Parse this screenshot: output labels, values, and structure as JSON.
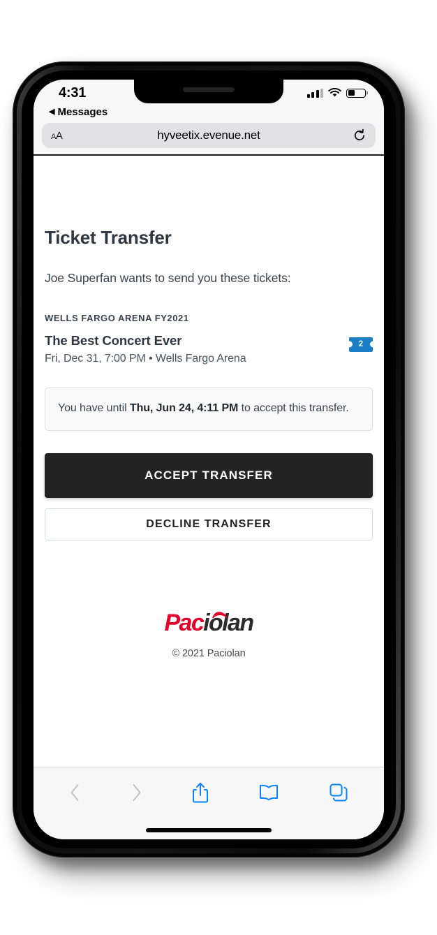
{
  "status_bar": {
    "time": "4:31",
    "back_label": "Messages",
    "back_caret": "◀",
    "signal_icon": "cellular-signal-icon",
    "wifi_icon": "wifi-icon",
    "battery_icon": "battery-icon",
    "battery_level_percent": 42
  },
  "browser": {
    "font_size_label_small": "A",
    "font_size_label_large": "A",
    "url": "hyveetix.evenue.net",
    "reload_icon": "reload-icon",
    "toolbar": {
      "back_icon": "chevron-left-icon",
      "forward_icon": "chevron-right-icon",
      "share_icon": "share-icon",
      "bookmarks_icon": "book-icon",
      "tabs_icon": "tabs-icon",
      "enabled_color": "#0a84ff",
      "disabled_color": "#c2c2c4"
    }
  },
  "page": {
    "title": "Ticket Transfer",
    "subtitle": "Joe Superfan wants to send you these tickets:",
    "event": {
      "group_name": "WELLS FARGO ARENA FY2021",
      "name": "The Best Concert Ever",
      "datetime_venue": "Fri, Dec 31, 7:00 PM • Wells Fargo Arena",
      "ticket_count": "2",
      "ticket_badge_color": "#1a7ec4",
      "ticket_badge_icon": "ticket-icon"
    },
    "deadline_notice": {
      "prefix": "You have until ",
      "date": "Thu, Jun 24, 4:11 PM",
      "suffix": " to accept this transfer."
    },
    "accept_button_label": "ACCEPT TRANSFER",
    "decline_button_label": "DECLINE TRANSFER",
    "footer": {
      "logo_part_red": "Pac",
      "logo_part_dark": "iolan",
      "logo_red_color": "#e4002b",
      "copyright": "© 2021 Paciolan"
    }
  }
}
